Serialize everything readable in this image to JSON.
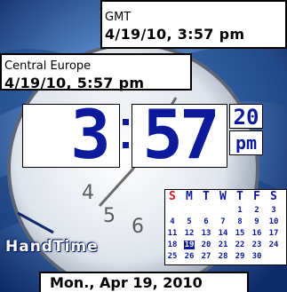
{
  "clocks": [
    {
      "zone": "GMT",
      "datetime": "4/19/10, 3:57 pm"
    },
    {
      "zone": "Central Europe",
      "datetime": "4/19/10, 5:57 pm"
    }
  ],
  "main_time": {
    "hours": "3",
    "minutes": "57",
    "seconds": "20",
    "ampm": "pm"
  },
  "calendar": {
    "day_headers": [
      "S",
      "M",
      "T",
      "W",
      "T",
      "F",
      "S"
    ],
    "weeks": [
      [
        "",
        "",
        "",
        "",
        "1",
        "2",
        "3"
      ],
      [
        "4",
        "5",
        "6",
        "7",
        "8",
        "9",
        "10"
      ],
      [
        "11",
        "12",
        "13",
        "14",
        "15",
        "16",
        "17"
      ],
      [
        "18",
        "19",
        "20",
        "21",
        "22",
        "23",
        "24"
      ],
      [
        "25",
        "26",
        "27",
        "28",
        "29",
        "30",
        ""
      ]
    ],
    "today": "19"
  },
  "app_logo": "HandTime",
  "footer_date": "Mon., Apr 19, 2010",
  "colors": {
    "digit_blue": "#0d1a9c",
    "sunday_red": "#e0181c",
    "background": "#2a5288"
  }
}
